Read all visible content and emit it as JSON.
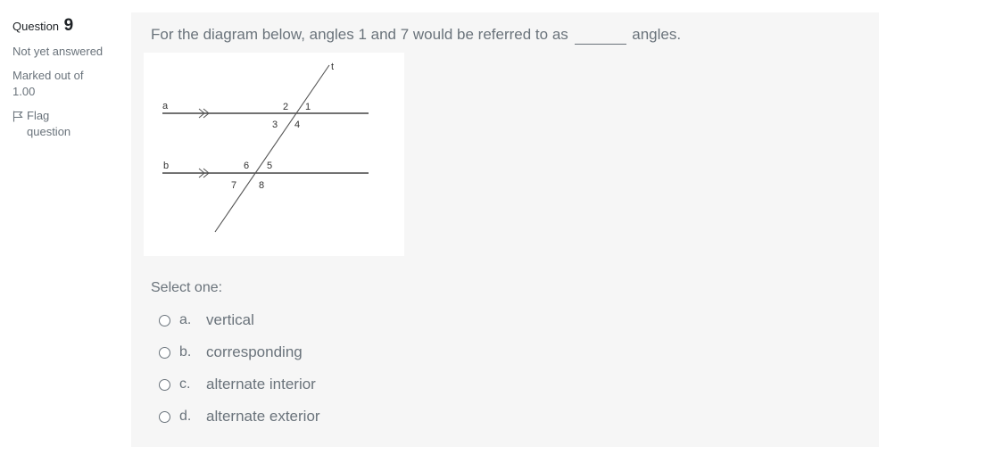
{
  "info": {
    "question_label": "Question",
    "question_number": "9",
    "state": "Not yet answered",
    "grade_line1": "Marked out of",
    "grade_line2": "1.00",
    "flag_line1": "Flag",
    "flag_line2": "question"
  },
  "question": {
    "text_before": "For the diagram below, angles 1 and 7 would be referred to as",
    "text_after": "angles.",
    "prompt": "Select one:"
  },
  "diagram": {
    "labels": {
      "line_a": "a",
      "line_b": "b",
      "transversal": "t",
      "angles": [
        "1",
        "2",
        "3",
        "4",
        "5",
        "6",
        "7",
        "8"
      ]
    }
  },
  "answers": [
    {
      "letter": "a.",
      "text": "vertical"
    },
    {
      "letter": "b.",
      "text": "corresponding"
    },
    {
      "letter": "c.",
      "text": "alternate interior"
    },
    {
      "letter": "d.",
      "text": "alternate exterior"
    }
  ],
  "colors": {
    "panel_background": "#f6f6f6",
    "text_muted": "#6a737b",
    "text_dark": "#1d2125"
  }
}
